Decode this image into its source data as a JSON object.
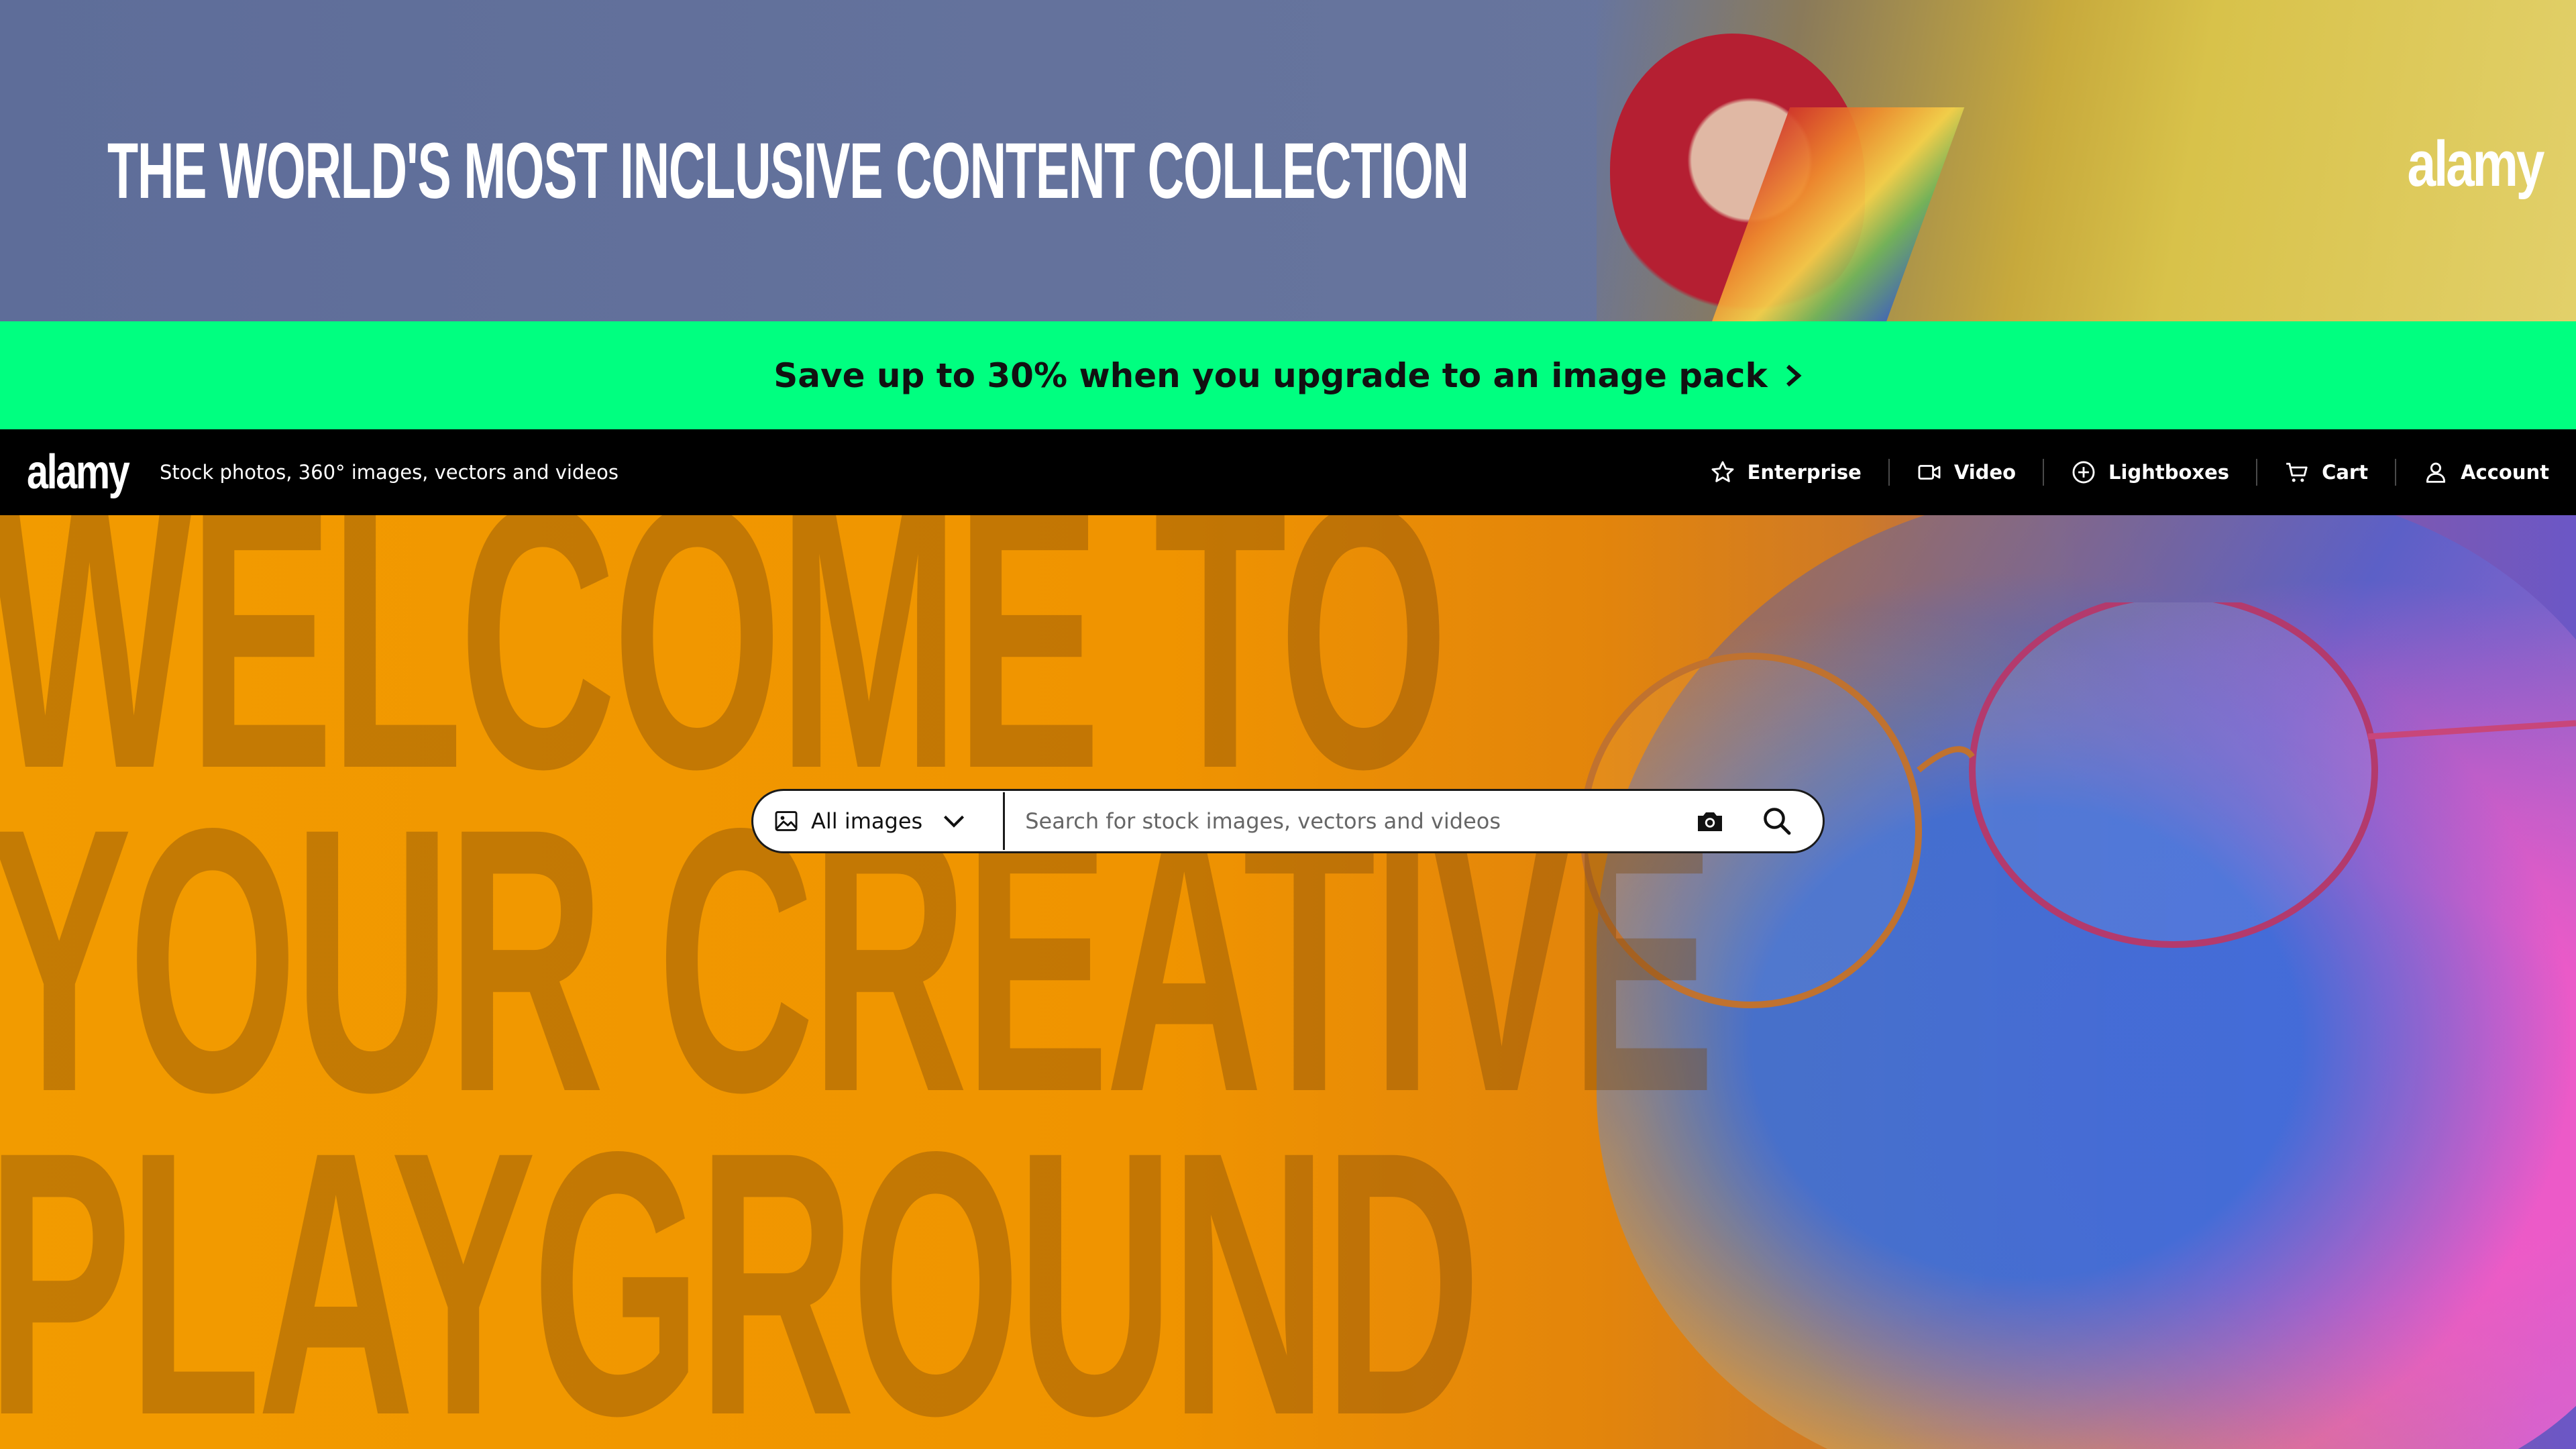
{
  "promo_banner": {
    "headline": "THE WORLD'S MOST INCLUSIVE CONTENT COLLECTION",
    "logo": "alamy",
    "background_color": "#5e6d99"
  },
  "upsell": {
    "text": "Save up to 30% when you upgrade to an image pack",
    "icon": "chevron-right-icon",
    "background_color": "#00ff80"
  },
  "header": {
    "logo": "alamy",
    "tagline": "Stock photos, 360° images, vectors and videos",
    "nav": [
      {
        "label": "Enterprise",
        "icon": "star-icon"
      },
      {
        "label": "Video",
        "icon": "video-camera-icon"
      },
      {
        "label": "Lightboxes",
        "icon": "plus-circle-icon"
      },
      {
        "label": "Cart",
        "icon": "cart-icon"
      },
      {
        "label": "Account",
        "icon": "user-icon"
      }
    ]
  },
  "hero": {
    "headline_lines": [
      "WELCOME TO",
      "YOUR CREATIVE",
      "PLAYGROUND"
    ],
    "accent_color": "#f29b00"
  },
  "search": {
    "type_label": "All images",
    "type_icon": "image-icon",
    "placeholder": "Search for stock images, vectors and videos",
    "value": "",
    "camera_icon": "camera-icon",
    "search_icon": "search-icon"
  }
}
